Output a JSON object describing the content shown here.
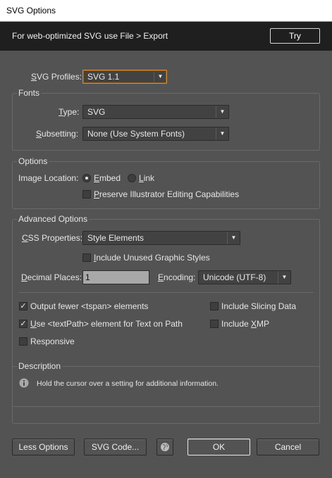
{
  "window": {
    "title": "SVG Options"
  },
  "banner": {
    "text": "For web-optimized SVG use File > Export",
    "try_label": "Try"
  },
  "profiles": {
    "label": "SVG Profiles:",
    "value": "SVG 1.1"
  },
  "fonts": {
    "title": "Fonts",
    "type_label": "Type:",
    "type_value": "SVG",
    "subsetting_label": "Subsetting:",
    "subsetting_value": "None (Use System Fonts)"
  },
  "options": {
    "title": "Options",
    "image_location_label": "Image Location:",
    "embed_label": "Embed",
    "link_label": "Link",
    "image_location_selected": "Embed",
    "preserve_label": "Preserve Illustrator Editing Capabilities",
    "preserve_checked": false
  },
  "advanced": {
    "title": "Advanced Options",
    "css_label": "CSS Properties:",
    "css_value": "Style Elements",
    "include_unused_label": "Include Unused Graphic Styles",
    "include_unused_checked": false,
    "decimal_label": "Decimal Places:",
    "decimal_value": "1",
    "encoding_label": "Encoding:",
    "encoding_value": "Unicode (UTF-8)",
    "fewer_tspan_label": "Output fewer <tspan> elements",
    "fewer_tspan_checked": true,
    "textpath_label": "Use <textPath> element for Text on Path",
    "textpath_checked": true,
    "responsive_label": "Responsive",
    "responsive_checked": false,
    "slicing_label": "Include Slicing Data",
    "slicing_checked": false,
    "xmp_label": "Include XMP",
    "xmp_checked": false
  },
  "description": {
    "title": "Description",
    "text": "Hold the cursor over a setting for additional information."
  },
  "buttons": {
    "less_options": "Less Options",
    "svg_code": "SVG Code...",
    "ok": "OK",
    "cancel": "Cancel"
  },
  "icons": {
    "info": "info-icon",
    "globe": "globe-icon",
    "dropdown": "chevron-down-icon"
  },
  "colors": {
    "focus_accent": "#d98a2e",
    "dialog_bg": "#535353",
    "banner_bg": "#1f1f1f"
  }
}
